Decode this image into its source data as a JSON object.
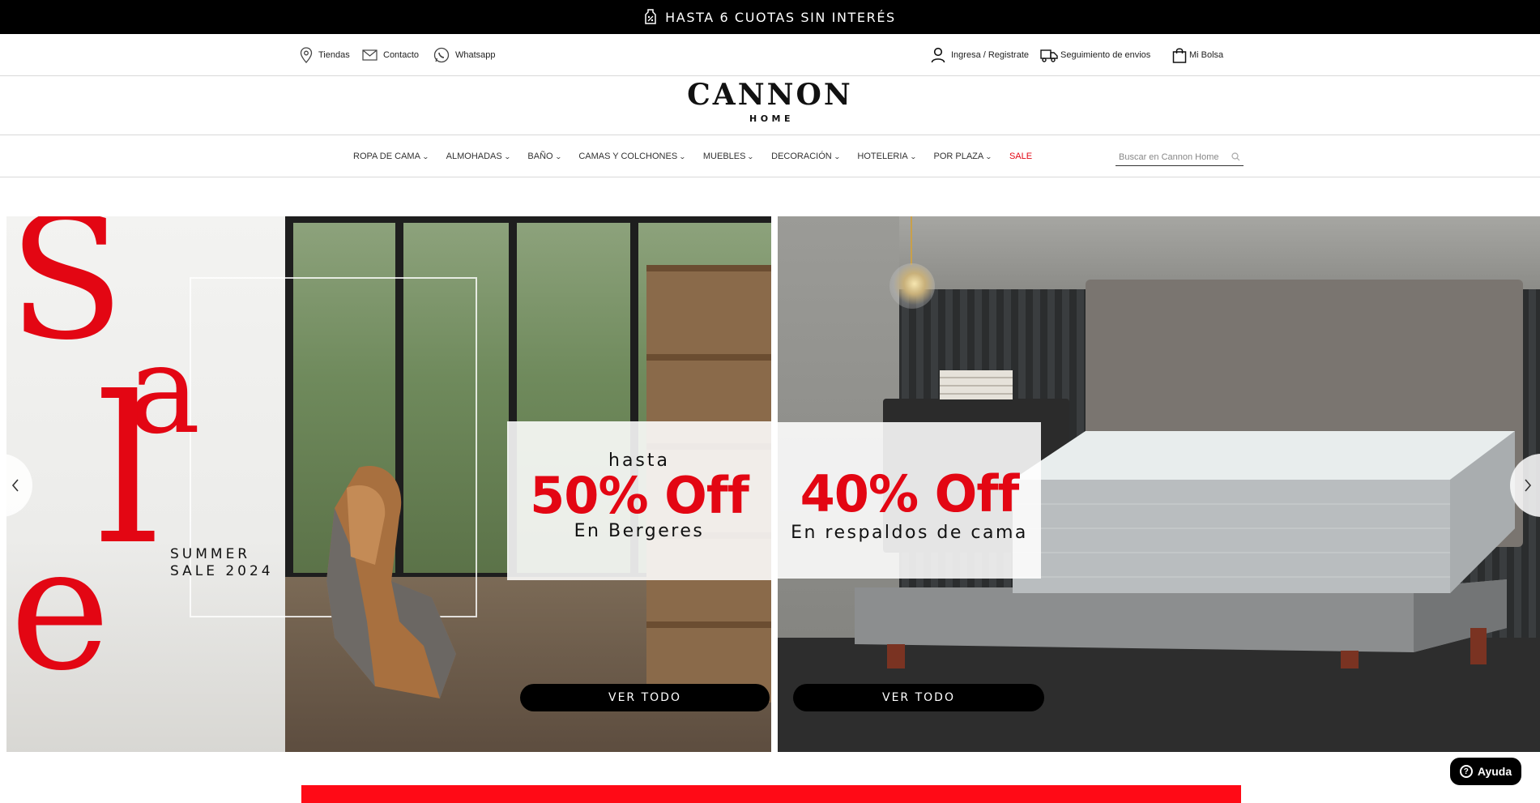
{
  "promo_bar": {
    "text": "HASTA 6 CUOTAS SIN INTERÉS",
    "icon": "percent-tag-icon"
  },
  "utility": {
    "stores": "Tiendas",
    "contact": "Contacto",
    "whatsapp": "Whatsapp",
    "login": "Ingresa / Registrate",
    "tracking": "Seguimiento de envios",
    "bag": "Mi Bolsa"
  },
  "logo": {
    "brand": "CANNON",
    "sub": "HOME"
  },
  "nav": {
    "items": [
      {
        "label": "ROPA DE CAMA"
      },
      {
        "label": "ALMOHADAS"
      },
      {
        "label": "BAÑO"
      },
      {
        "label": "CAMAS Y COLCHONES"
      },
      {
        "label": "MUEBLES"
      },
      {
        "label": "DECORACIÓN"
      },
      {
        "label": "HOTELERIA"
      },
      {
        "label": "POR PLAZA"
      }
    ],
    "sale": "SALE",
    "search_placeholder": "Buscar en Cannon Home"
  },
  "banner_left": {
    "big_letters": [
      "S",
      "a",
      "l",
      "e"
    ],
    "summer_line1": "SUMMER",
    "summer_line2": "SALE 2024",
    "small": "hasta",
    "pct": "50% Off",
    "desc": "En Bergeres",
    "button": "VER TODO"
  },
  "banner_right": {
    "pct": "40% Off",
    "desc": "En respaldos de cama",
    "button": "VER TODO"
  },
  "help": {
    "label": "Ayuda"
  },
  "colors": {
    "accent_red": "#e30613",
    "black": "#000000"
  }
}
